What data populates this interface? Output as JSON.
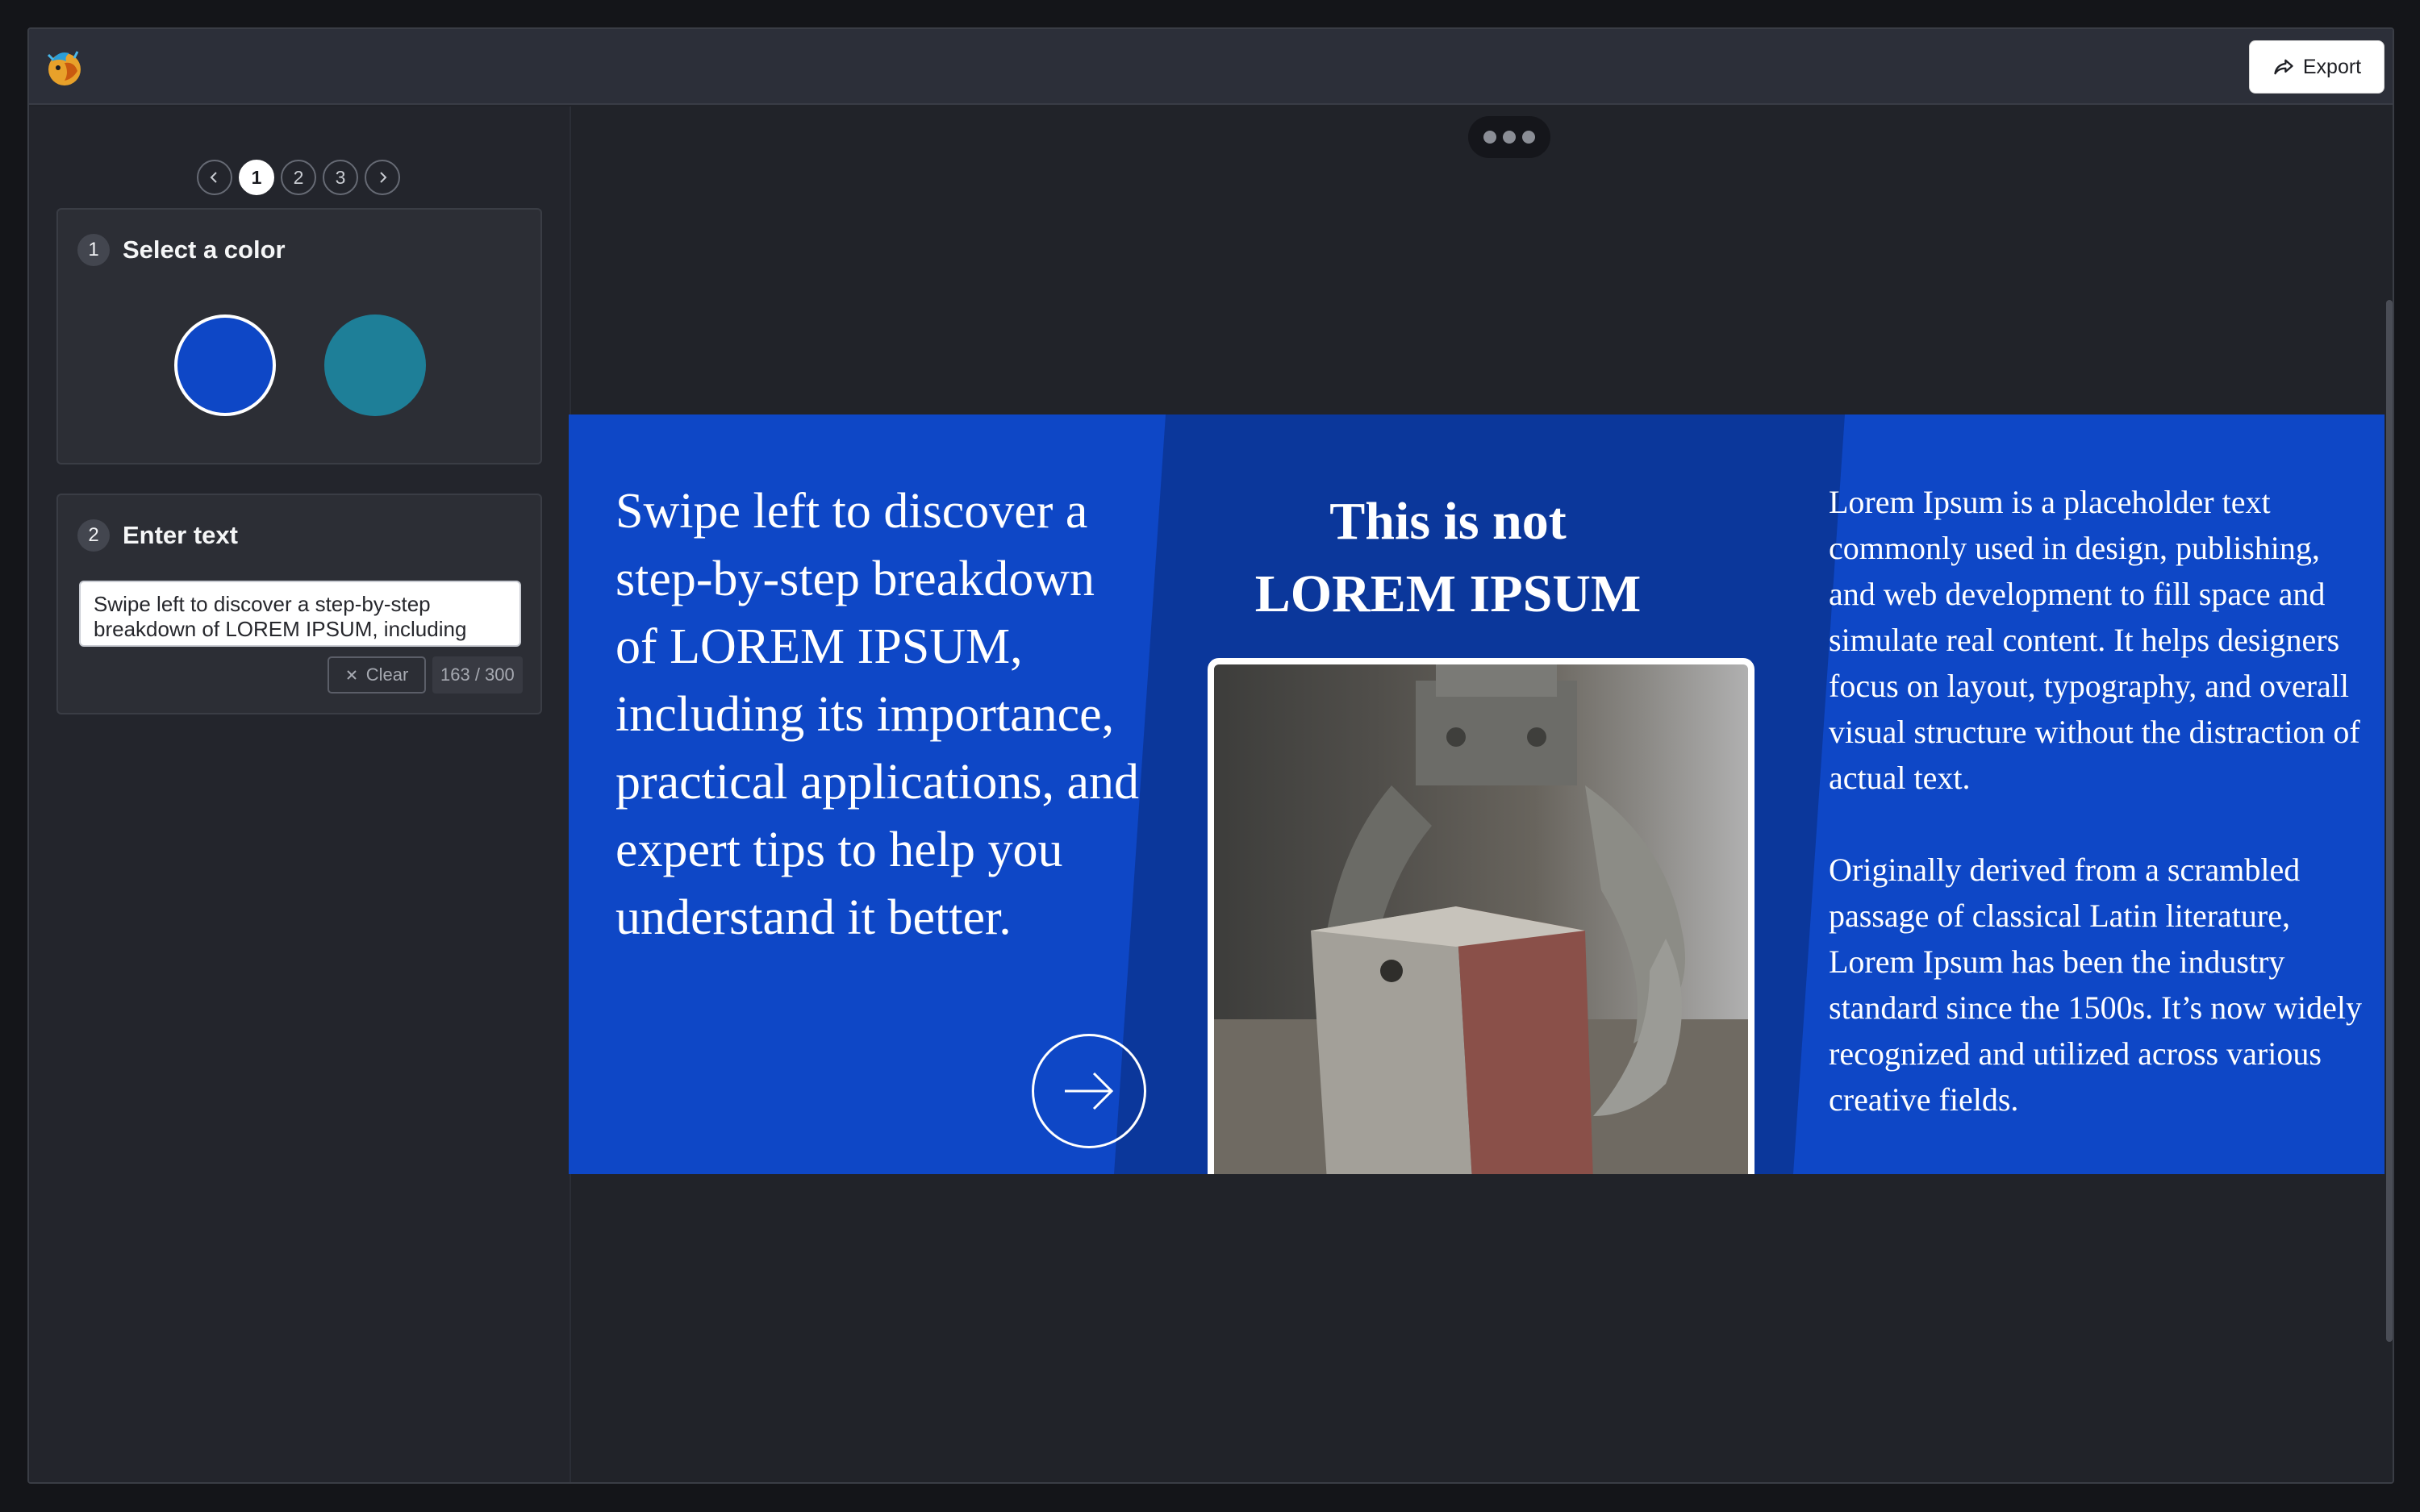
{
  "header": {
    "export_label": "Export"
  },
  "pager": {
    "pages": [
      "1",
      "2",
      "3"
    ],
    "current": "1"
  },
  "steps": [
    {
      "number": "1",
      "title": "Select a color"
    },
    {
      "number": "2",
      "title": "Enter text"
    }
  ],
  "colors": {
    "selected": "#0e47c6",
    "options": [
      "#0e47c6",
      "#1e7f98"
    ]
  },
  "text_input": {
    "value": "Swipe left to discover a step-by-step breakdown of LOREM IPSUM, including",
    "clear_label": "Clear",
    "char_count": "163 / 300"
  },
  "slide": {
    "intro": "Swipe left to discover a step-by-step breakdown of LOREM IPSUM, including its importance, practical applications, and expert tips to help you understand it better.",
    "headline_line1": "This is not",
    "headline_line2": "LOREM IPSUM",
    "body_p1": "Lorem Ipsum is a placeholder text commonly used in design, publishing, and web development to fill space and simulate real content. It helps designers focus on layout, typography, and overall visual structure without the distraction of actual text.",
    "body_p2": "Originally derived from a scrambled passage of classical Latin literature, Lorem Ipsum has been the industry standard since the 1500s. It’s now widely recognized and utilized across various creative fields."
  },
  "icons": {
    "logo": "app-logo-icon",
    "export": "share-arrow-icon",
    "prev": "chevron-left-icon",
    "next": "chevron-right-icon",
    "clear": "x-icon",
    "slide_next": "arrow-right-icon"
  }
}
